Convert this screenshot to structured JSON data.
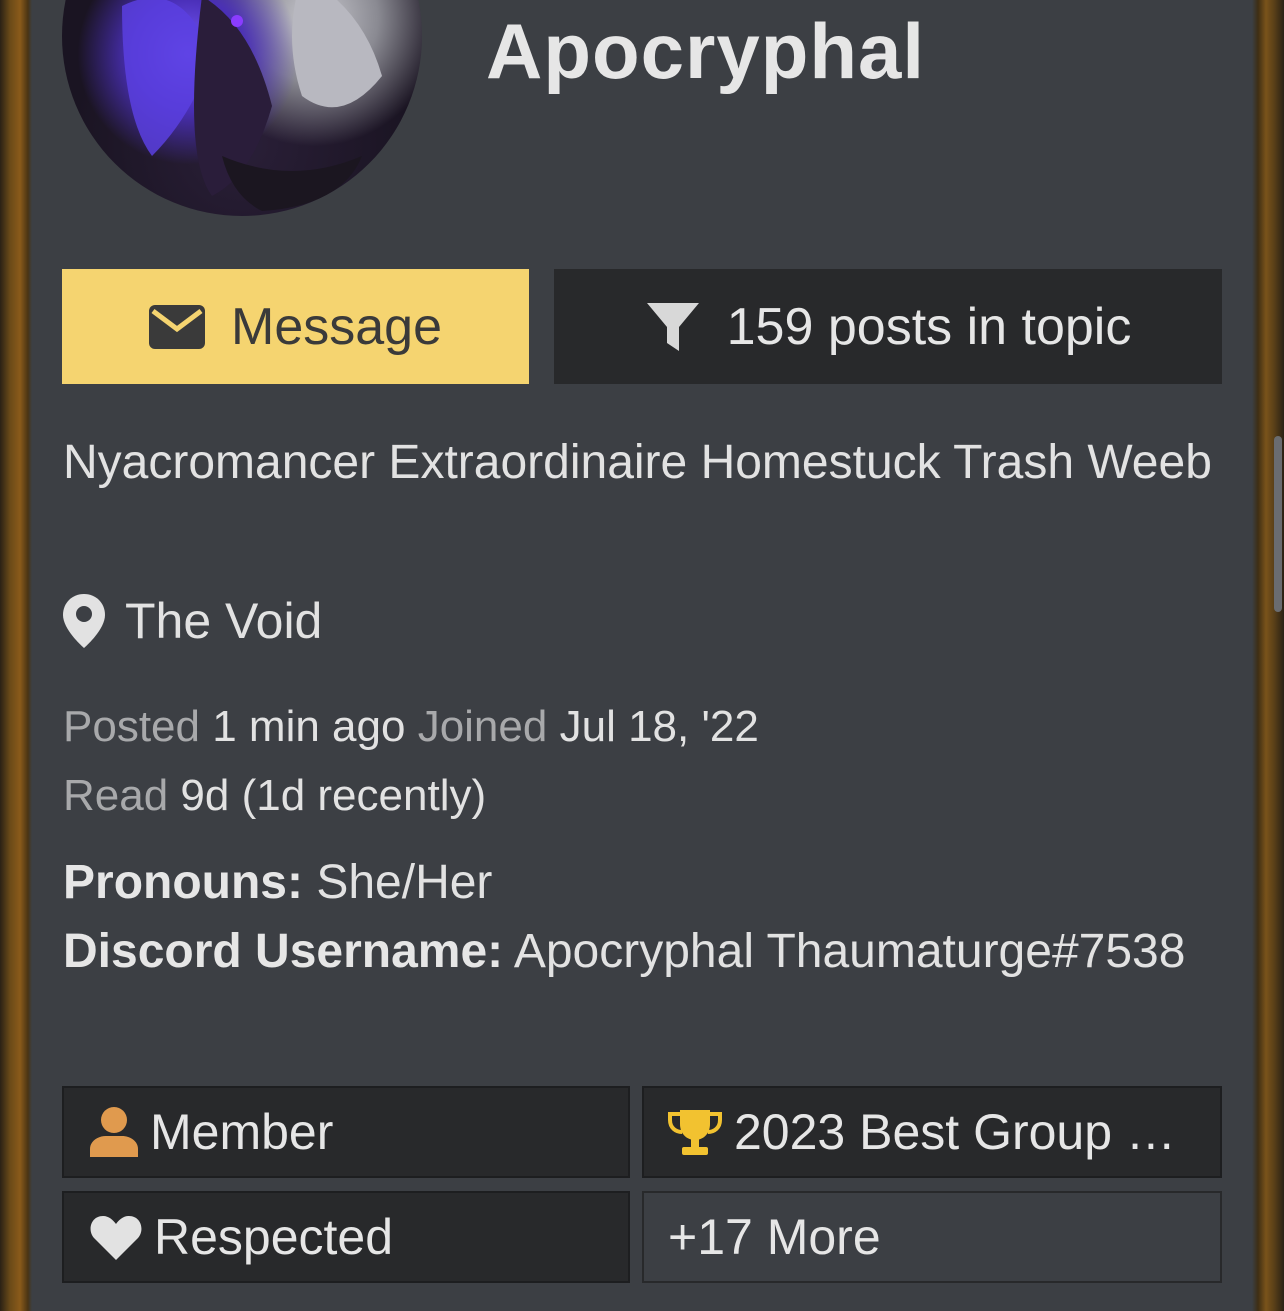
{
  "profile": {
    "username": "Apocryphal",
    "avatar_alt": "avatar",
    "title": "Nyacromancer Extraordinaire Homestuck Trash Weeb",
    "location": "The Void"
  },
  "actions": {
    "message_label": "Message",
    "posts_label": "159 posts in topic"
  },
  "meta": {
    "posted_label": "Posted",
    "posted_value": "1 min ago",
    "joined_label": "Joined",
    "joined_value": "Jul 18, '22",
    "read_label": "Read",
    "read_value": "9d (1d recently)"
  },
  "fields": {
    "pronouns_label": "Pronouns:",
    "pronouns_value": "She/Her",
    "discord_label": "Discord Username:",
    "discord_value": "Apocryphal Thaumaturge#7538"
  },
  "badges": {
    "member": "Member",
    "award": "2023 Best Group …",
    "respected": "Respected",
    "more": "+17 More"
  },
  "colors": {
    "card_bg": "#3c3f44",
    "message_btn": "#f5d470",
    "dark_btn": "#28292b",
    "member_icon": "#e09a4e",
    "trophy_icon": "#f2c230",
    "frame": "#8a5a1a"
  },
  "icons": {
    "message": "envelope-icon",
    "posts": "filter-icon",
    "location": "map-pin-icon",
    "member": "user-icon",
    "award": "trophy-icon",
    "respected": "heart-icon"
  }
}
